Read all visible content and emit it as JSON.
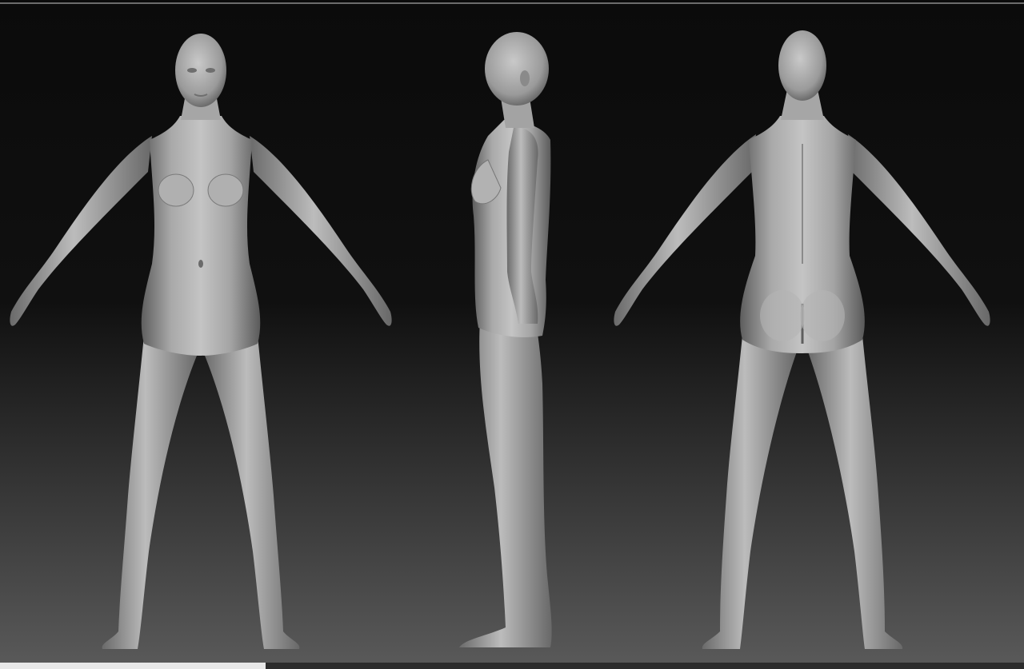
{
  "scene": {
    "description_tag": "sculpt-turnaround",
    "views": [
      {
        "id": "front",
        "icon": "figure-front-icon"
      },
      {
        "id": "side",
        "icon": "figure-side-icon"
      },
      {
        "id": "back",
        "icon": "figure-back-icon"
      }
    ],
    "colors": {
      "background_top": "#0d0d0d",
      "background_bottom": "#565656",
      "material_light": "#bdbdbd",
      "material_mid": "#8e8e8e",
      "material_dark": "#4a4a4a"
    }
  }
}
